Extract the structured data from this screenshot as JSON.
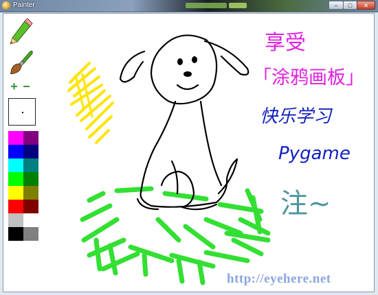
{
  "window": {
    "title": "Painter",
    "controls": {
      "minimize": "–",
      "maximize": "□",
      "close": "✕"
    }
  },
  "toolbar": {
    "tools": [
      {
        "name": "pencil",
        "icon": "pencil-icon"
      },
      {
        "name": "brush",
        "icon": "paintbrush-icon"
      }
    ],
    "size_increase_label": "+",
    "size_decrease_label": "−",
    "brush_size": 1
  },
  "palette": {
    "colors": [
      "#ff00ff",
      "#800080",
      "#0000ff",
      "#000080",
      "#00ffff",
      "#008080",
      "#00ff00",
      "#008000",
      "#ffff00",
      "#808000",
      "#ff0000",
      "#800000",
      "#c0c0c0",
      "#ffffff",
      "#000000",
      "#808080"
    ]
  },
  "canvas_text": {
    "line1": "享受",
    "line2": "「涂鸦画板」",
    "line3": "快乐学习",
    "line4": "Pygame",
    "line5": "注~"
  },
  "watermark": "http://eyehere.net",
  "colors": {
    "magenta_text": "#e020e0",
    "blue_text": "#1020c0",
    "teal_text": "#3a8a95",
    "yellow_stroke": "#ffe400",
    "green_stroke": "#22dd22"
  }
}
